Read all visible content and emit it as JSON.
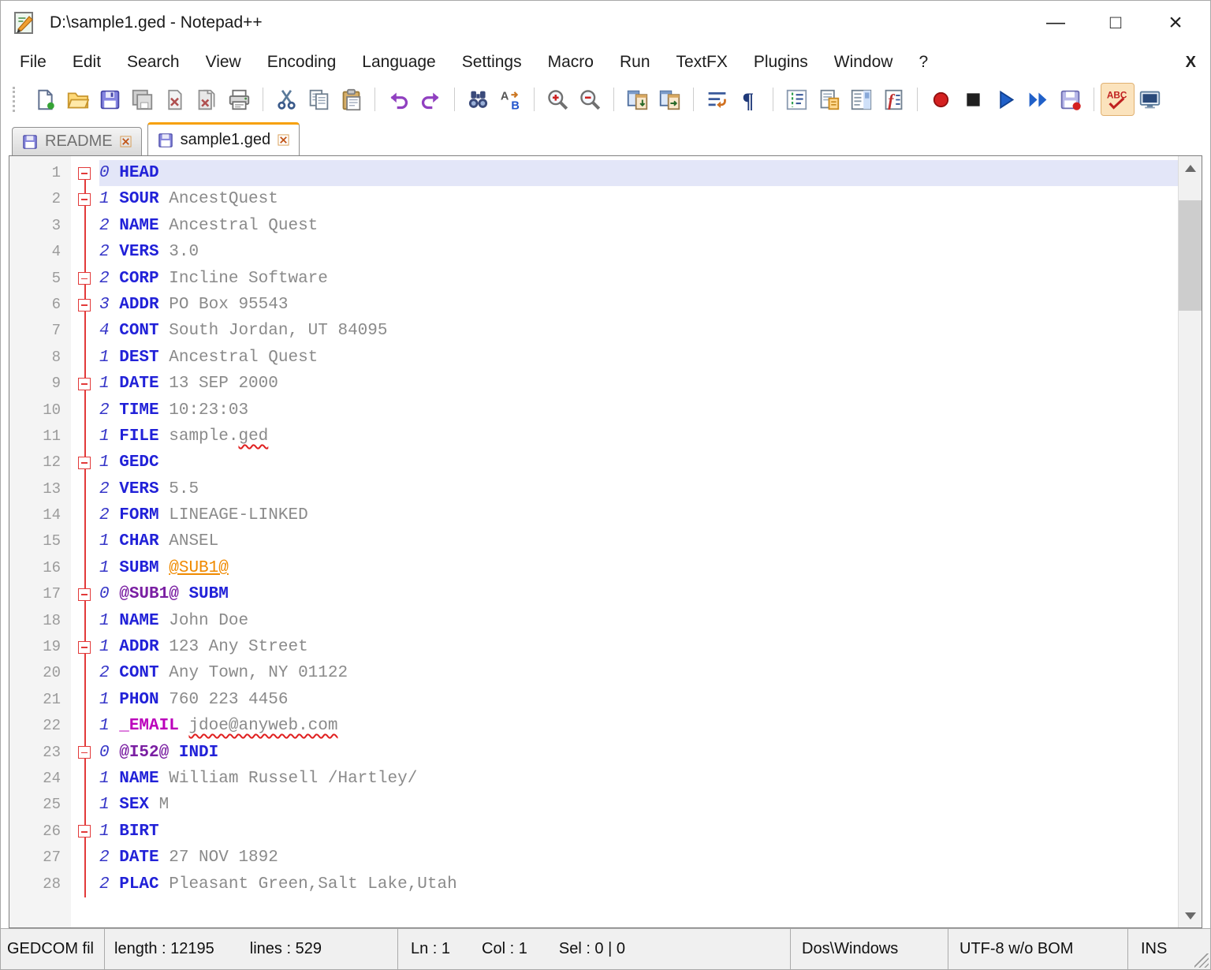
{
  "window": {
    "title": "D:\\sample1.ged - Notepad++",
    "controls": {
      "minimize": "—",
      "maximize": "□",
      "close": "×"
    }
  },
  "menu_bar": {
    "items": [
      "File",
      "Edit",
      "Search",
      "View",
      "Encoding",
      "Language",
      "Settings",
      "Macro",
      "Run",
      "TextFX",
      "Plugins",
      "Window",
      "?"
    ],
    "close_button": "X"
  },
  "toolbar": {
    "groups": [
      [
        "new-file",
        "open-file",
        "save",
        "save-all",
        "close-file",
        "close-all",
        "print"
      ],
      [
        "cut",
        "copy",
        "paste"
      ],
      [
        "undo",
        "redo"
      ],
      [
        "find",
        "replace"
      ],
      [
        "zoom-in",
        "zoom-out"
      ],
      [
        "sync-scroll-vertical",
        "sync-scroll-horizontal"
      ],
      [
        "word-wrap",
        "show-all-characters"
      ],
      [
        "indent-guide",
        "doc-switcher",
        "document-map",
        "function-list"
      ],
      [
        "macro-record",
        "macro-stop",
        "macro-play",
        "macro-run-multiple",
        "macro-save"
      ],
      [
        "spell-check",
        "console"
      ]
    ]
  },
  "tabs": [
    {
      "label": "README",
      "active": false
    },
    {
      "label": "sample1.ged",
      "active": true
    }
  ],
  "editor": {
    "current_line": 1,
    "lines": [
      {
        "num": 1,
        "fold": "minus",
        "parts": [
          [
            "level",
            "0 "
          ],
          [
            "tag",
            "HEAD"
          ]
        ]
      },
      {
        "num": 2,
        "fold": "minus",
        "parts": [
          [
            "level",
            "1 "
          ],
          [
            "tag",
            "SOUR"
          ],
          [
            "value",
            " AncestQuest"
          ]
        ]
      },
      {
        "num": 3,
        "fold": "line",
        "parts": [
          [
            "level",
            "2 "
          ],
          [
            "tag",
            "NAME"
          ],
          [
            "value",
            " Ancestral Quest"
          ]
        ]
      },
      {
        "num": 4,
        "fold": "line",
        "parts": [
          [
            "level",
            "2 "
          ],
          [
            "tag",
            "VERS"
          ],
          [
            "value",
            " 3.0"
          ]
        ]
      },
      {
        "num": 5,
        "fold": "minus",
        "parts": [
          [
            "level",
            "2 "
          ],
          [
            "tag",
            "CORP"
          ],
          [
            "value",
            " Incline Software"
          ]
        ]
      },
      {
        "num": 6,
        "fold": "minus",
        "parts": [
          [
            "level",
            "3 "
          ],
          [
            "tag",
            "ADDR"
          ],
          [
            "value",
            " PO Box 95543"
          ]
        ]
      },
      {
        "num": 7,
        "fold": "line",
        "parts": [
          [
            "level",
            "4 "
          ],
          [
            "tag",
            "CONT"
          ],
          [
            "value",
            " South Jordan, UT 84095"
          ]
        ]
      },
      {
        "num": 8,
        "fold": "line",
        "parts": [
          [
            "level",
            "1 "
          ],
          [
            "tag",
            "DEST"
          ],
          [
            "value",
            " Ancestral Quest"
          ]
        ]
      },
      {
        "num": 9,
        "fold": "minus",
        "parts": [
          [
            "level",
            "1 "
          ],
          [
            "tag",
            "DATE"
          ],
          [
            "value",
            " 13 SEP 2000"
          ]
        ]
      },
      {
        "num": 10,
        "fold": "line",
        "parts": [
          [
            "level",
            "2 "
          ],
          [
            "tag",
            "TIME"
          ],
          [
            "value",
            " 10:23:03"
          ]
        ]
      },
      {
        "num": 11,
        "fold": "line",
        "parts": [
          [
            "level",
            "1 "
          ],
          [
            "tag",
            "FILE"
          ],
          [
            "value",
            " sample."
          ],
          [
            "misspell",
            "ged"
          ]
        ]
      },
      {
        "num": 12,
        "fold": "minus",
        "parts": [
          [
            "level",
            "1 "
          ],
          [
            "tag",
            "GEDC"
          ]
        ]
      },
      {
        "num": 13,
        "fold": "line",
        "parts": [
          [
            "level",
            "2 "
          ],
          [
            "tag",
            "VERS"
          ],
          [
            "value",
            " 5.5"
          ]
        ]
      },
      {
        "num": 14,
        "fold": "line",
        "parts": [
          [
            "level",
            "2 "
          ],
          [
            "tag",
            "FORM"
          ],
          [
            "value",
            " LINEAGE-LINKED"
          ]
        ]
      },
      {
        "num": 15,
        "fold": "line",
        "parts": [
          [
            "level",
            "1 "
          ],
          [
            "tag",
            "CHAR"
          ],
          [
            "value",
            " ANSEL"
          ]
        ]
      },
      {
        "num": 16,
        "fold": "line",
        "parts": [
          [
            "level",
            "1 "
          ],
          [
            "tag",
            "SUBM"
          ],
          [
            "value",
            " "
          ],
          [
            "reflink",
            "@SUB1@"
          ]
        ]
      },
      {
        "num": 17,
        "fold": "minus",
        "parts": [
          [
            "level",
            "0 "
          ],
          [
            "ref",
            "@SUB1@"
          ],
          [
            "value",
            " "
          ],
          [
            "tag",
            "SUBM"
          ]
        ]
      },
      {
        "num": 18,
        "fold": "line",
        "parts": [
          [
            "level",
            "1 "
          ],
          [
            "tag",
            "NAME"
          ],
          [
            "value",
            " John Doe"
          ]
        ]
      },
      {
        "num": 19,
        "fold": "minus",
        "parts": [
          [
            "level",
            "1 "
          ],
          [
            "tag",
            "ADDR"
          ],
          [
            "value",
            " 123 Any Street"
          ]
        ]
      },
      {
        "num": 20,
        "fold": "line",
        "parts": [
          [
            "level",
            "2 "
          ],
          [
            "tag",
            "CONT"
          ],
          [
            "value",
            " Any Town, NY 01122"
          ]
        ]
      },
      {
        "num": 21,
        "fold": "line",
        "parts": [
          [
            "level",
            "1 "
          ],
          [
            "tag",
            "PHON"
          ],
          [
            "value",
            " 760 223 4456"
          ]
        ]
      },
      {
        "num": 22,
        "fold": "line",
        "parts": [
          [
            "level",
            "1 "
          ],
          [
            "emailtag",
            "_EMAIL"
          ],
          [
            "value",
            " "
          ],
          [
            "misspell",
            "jdoe@anyweb.com"
          ]
        ]
      },
      {
        "num": 23,
        "fold": "minus",
        "parts": [
          [
            "level",
            "0 "
          ],
          [
            "ref",
            "@I52@"
          ],
          [
            "value",
            " "
          ],
          [
            "tag",
            "INDI"
          ]
        ]
      },
      {
        "num": 24,
        "fold": "line",
        "parts": [
          [
            "level",
            "1 "
          ],
          [
            "tag",
            "NAME"
          ],
          [
            "value",
            " William Russell /Hartley/"
          ]
        ]
      },
      {
        "num": 25,
        "fold": "line",
        "parts": [
          [
            "level",
            "1 "
          ],
          [
            "tag",
            "SEX"
          ],
          [
            "value",
            " M"
          ]
        ]
      },
      {
        "num": 26,
        "fold": "minus",
        "parts": [
          [
            "level",
            "1 "
          ],
          [
            "tag",
            "BIRT"
          ]
        ]
      },
      {
        "num": 27,
        "fold": "line",
        "parts": [
          [
            "level",
            "2 "
          ],
          [
            "tag",
            "DATE"
          ],
          [
            "value",
            " 27 NOV 1892"
          ]
        ]
      },
      {
        "num": 28,
        "fold": "line",
        "parts": [
          [
            "level",
            "2 "
          ],
          [
            "tag",
            "PLAC"
          ],
          [
            "value",
            " Pleasant Green,Salt Lake,Utah"
          ]
        ]
      }
    ]
  },
  "status_bar": {
    "doc_type": "GEDCOM fil",
    "length": "length : 12195",
    "lines": "lines : 529",
    "ln": "Ln : 1",
    "col": "Col : 1",
    "sel": "Sel : 0 | 0",
    "eol_format": "Dos\\Windows",
    "encoding": "UTF-8 w/o BOM",
    "insert_mode": "INS"
  },
  "colors": {
    "active_tab_accent": "#f7a10a",
    "fold_marker": "#e23a3a",
    "tag_text": "#2121d8",
    "level_text": "#3636c8",
    "value_text": "#8a8a8a",
    "reference_link": "#ef8a00",
    "email_tag": "#bb00bb",
    "current_line_bg": "#e3e6f8"
  }
}
